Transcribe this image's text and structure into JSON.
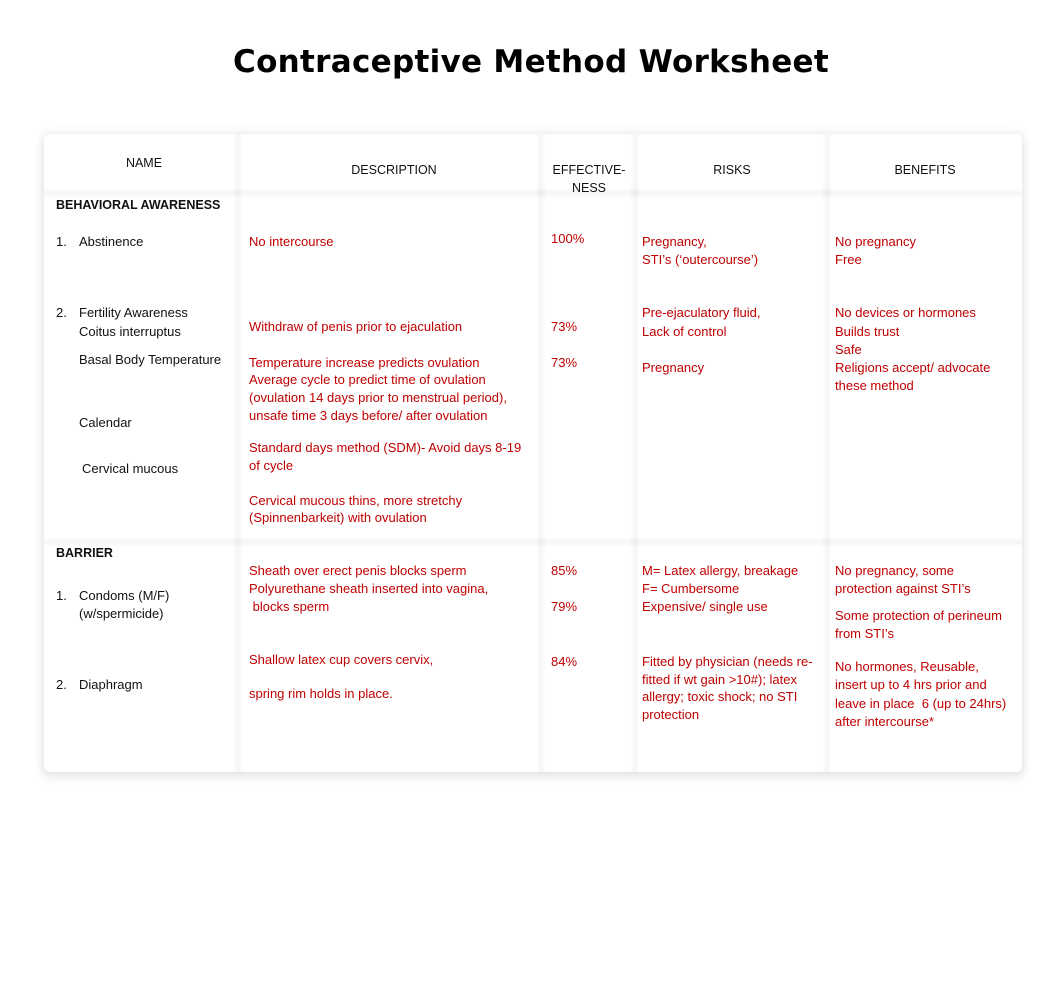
{
  "document": {
    "title": "Contraceptive Method Worksheet"
  },
  "table": {
    "headers": {
      "name": "NAME",
      "description": "DESCRIPTION",
      "effectiveness_line1": "EFFECTIVE-",
      "effectiveness_line2": "NESS",
      "risks": "RISKS",
      "benefits": "BENEFITS"
    },
    "sections": [
      {
        "title": "BEHAVIORAL AWARENESS",
        "methods": [
          {
            "number": "1.",
            "name": "Abstinence",
            "description": [
              "No intercourse"
            ],
            "effectiveness": [
              "100%"
            ],
            "risks": [
              "Pregnancy,",
              "STI’s (‘outercourse’)"
            ],
            "benefits": [
              "No pregnancy",
              "Free"
            ]
          },
          {
            "number": "2.",
            "name": "Fertility Awareness",
            "sub_methods": [
              "Coitus interruptus",
              "Basal Body Temperature",
              "Calendar",
              "Cervical mucous"
            ],
            "description": [
              "Withdraw of penis prior to ejaculation",
              "Temperature increase predicts ovulation",
              "Average cycle to predict time of ovulation",
              "(ovulation 14 days prior to menstrual period),",
              "unsafe time 3 days before/ after ovulation",
              "Standard days method (SDM)- Avoid days 8-19",
              "of cycle",
              "Cervical mucous thins, more stretchy",
              "(Spinnenbarkeit) with ovulation"
            ],
            "effectiveness": [
              "73%",
              "73%"
            ],
            "risks": [
              "Pre-ejaculatory fluid,",
              "Lack of control",
              "Pregnancy"
            ],
            "benefits": [
              "No devices or hormones",
              "Builds trust",
              "Safe",
              "Religions accept/ advocate",
              "these method"
            ]
          }
        ]
      },
      {
        "title": "BARRIER",
        "methods": [
          {
            "number": "1.",
            "name": "Condoms (M/F)",
            "name_line2": "(w/spermicide)",
            "description": [
              "Sheath over erect penis blocks sperm",
              "Polyurethane sheath inserted into vagina,",
              " blocks sperm"
            ],
            "effectiveness": [
              "85%",
              "79%"
            ],
            "risks": [
              "M= Latex allergy, breakage",
              "F= Cumbersome",
              "Expensive/ single use"
            ],
            "benefits": [
              "No pregnancy, some",
              "protection against STI’s",
              "Some protection of perineum",
              "from STI’s"
            ]
          },
          {
            "number": "2.",
            "name": "Diaphragm",
            "description": [
              "Shallow latex cup covers cervix,",
              "spring rim holds in place."
            ],
            "effectiveness": [
              "84%"
            ],
            "risks": [
              "Fitted by physician (needs re-",
              "fitted if wt gain >10#); latex",
              "allergy; toxic shock; no STI",
              "protection"
            ],
            "benefits": [
              "No hormones, Reusable,",
              "insert up to 4 hrs prior and",
              "leave in place  6 (up to 24hrs)",
              "after intercourse*"
            ]
          }
        ]
      }
    ]
  },
  "colors": {
    "answer_text": "#c00000",
    "label_text": "#111111"
  }
}
